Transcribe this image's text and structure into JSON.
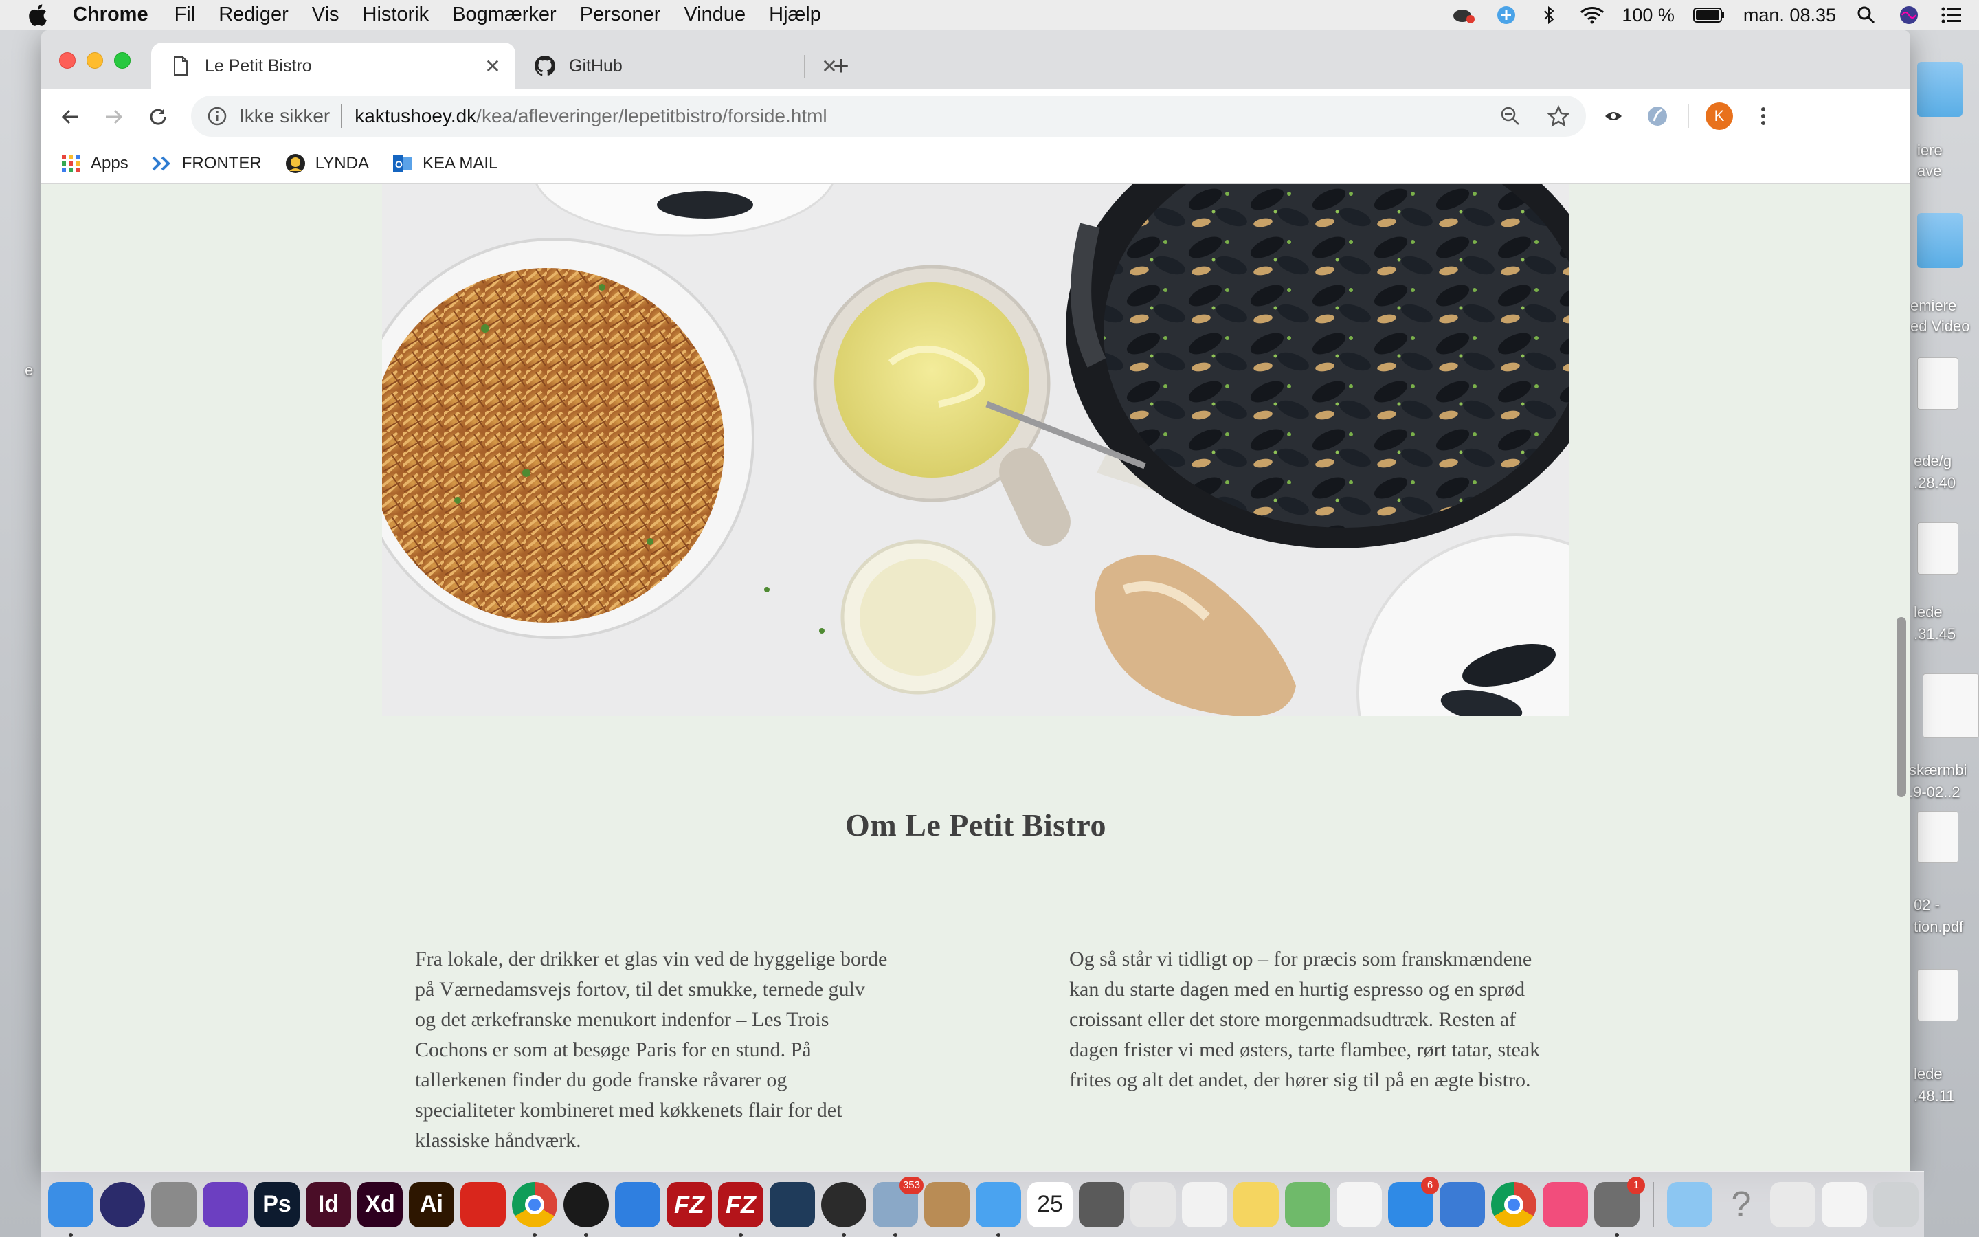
{
  "menubar": {
    "app_name": "Chrome",
    "menus": [
      "Fil",
      "Rediger",
      "Vis",
      "Historik",
      "Bogmærker",
      "Personer",
      "Vindue",
      "Hjælp"
    ],
    "battery": "100 %",
    "clock": "man. 08.35"
  },
  "desktop_labels": [
    "iere",
    "ave",
    "emiere",
    "ed Video",
    "ede/g",
    ".28.40",
    "lede",
    ".31.45",
    "skærmbi",
    ".9-02..2",
    "02 -",
    "tion.pdf",
    "lede",
    ".48.11",
    "e"
  ],
  "browser": {
    "tabs": [
      {
        "label": "Le Petit Bistro",
        "icon": "document-icon",
        "active": true
      },
      {
        "label": "GitHub",
        "icon": "github-icon",
        "active": false
      }
    ],
    "new_tab_symbol": "+",
    "close_symbol": "✕",
    "address": {
      "security_label": "Ikke sikker",
      "host": "kaktushoey.dk",
      "path": "/kea/afleveringer/lepetitbistro/forside.html"
    },
    "profile_initial": "K",
    "bookmarks": [
      {
        "label": "Apps",
        "icon": "apps-grid-icon"
      },
      {
        "label": "FRONTER",
        "icon": "fronter-chevrons-icon"
      },
      {
        "label": "LYNDA",
        "icon": "lynda-icon"
      },
      {
        "label": "KEA MAIL",
        "icon": "outlook-icon"
      }
    ]
  },
  "page": {
    "hero_alt": "Moules frites",
    "heading": "Om Le Petit Bistro",
    "col_left": "Fra lokale, der drikker et glas vin ved de hyggelige borde på Værnedamsvejs fortov, til det smukke, ternede gulv og det ærkefranske menukort indenfor – Les Trois Cochons er som at besøge Paris for en stund. På tallerkenen finder du gode franske råvarer og specialiteter kombineret med køkkenets flair for det klassiske håndværk.",
    "col_right": "Og så står vi tidligt op – for præcis som franskmændene kan du starte dagen med en hurtig espresso og en sprød croissant eller det store morgenmadsudtræk. Resten af dagen frister vi med østers, tarte flambee, rørt tatar, steak frites og alt det andet, der hører sig til på en ægte bistro."
  },
  "dock": {
    "apps": [
      {
        "name": "finder",
        "label": "",
        "color": "#3a8ee6"
      },
      {
        "name": "siri",
        "label": "",
        "color": "#2b2b6b"
      },
      {
        "name": "launchpad",
        "label": "",
        "color": "#8a8a8a"
      },
      {
        "name": "imovie",
        "label": "",
        "color": "#6c3fc1"
      },
      {
        "name": "photoshop",
        "label": "Ps",
        "color": "#0d1b2f"
      },
      {
        "name": "indesign",
        "label": "Id",
        "color": "#4a0d27"
      },
      {
        "name": "xd",
        "label": "Xd",
        "color": "#2e001f"
      },
      {
        "name": "illustrator",
        "label": "Ai",
        "color": "#2d1600"
      },
      {
        "name": "creative-cloud",
        "label": "",
        "color": "#d9261c"
      },
      {
        "name": "chrome",
        "label": "",
        "color": "#ffffff"
      },
      {
        "name": "spotify",
        "label": "",
        "color": "#1a1a1a"
      },
      {
        "name": "safari",
        "label": "",
        "color": "#2f7fe0"
      },
      {
        "name": "filezilla",
        "label": "FZ",
        "color": "#b4141a"
      },
      {
        "name": "filezilla-2",
        "label": "FZ",
        "color": "#b4141a"
      },
      {
        "name": "brackets",
        "label": "",
        "color": "#1f3b5a"
      },
      {
        "name": "obs",
        "label": "",
        "color": "#2b2b2b"
      },
      {
        "name": "mail",
        "label": "",
        "color": "#8aa8c7",
        "badge": "353"
      },
      {
        "name": "contacts",
        "label": "",
        "color": "#b98c55"
      },
      {
        "name": "messages",
        "label": "",
        "color": "#4aa3f0"
      },
      {
        "name": "calendar",
        "label": "25",
        "color": "#ffffff"
      },
      {
        "name": "calculator",
        "label": "",
        "color": "#5a5a5a"
      },
      {
        "name": "textedit",
        "label": "",
        "color": "#e6e6e6"
      },
      {
        "name": "reminders",
        "label": "",
        "color": "#f2f2f2"
      },
      {
        "name": "notes",
        "label": "",
        "color": "#f5d560"
      },
      {
        "name": "maps",
        "label": "",
        "color": "#6fba6a"
      },
      {
        "name": "photos",
        "label": "",
        "color": "#f4f4f4"
      },
      {
        "name": "app-store",
        "label": "",
        "color": "#2f8ae6",
        "badge": "6"
      },
      {
        "name": "keynote",
        "label": "",
        "color": "#3b7bd5"
      },
      {
        "name": "chrome-2",
        "label": "",
        "color": "#ffffff"
      },
      {
        "name": "itunes",
        "label": "",
        "color": "#f24d7c"
      },
      {
        "name": "system-preferences",
        "label": "",
        "color": "#6e6e6e",
        "badge": "1"
      },
      {
        "name": "downloads-folder",
        "label": "",
        "color": "#8cc6f2"
      },
      {
        "name": "help",
        "label": "?",
        "color": "transparent"
      },
      {
        "name": "preview-doc",
        "label": "",
        "color": "#e9e9e9"
      },
      {
        "name": "window-thumb",
        "label": "",
        "color": "#f4f4f4"
      },
      {
        "name": "trash",
        "label": "",
        "color": "#cfd2d4"
      }
    ]
  }
}
